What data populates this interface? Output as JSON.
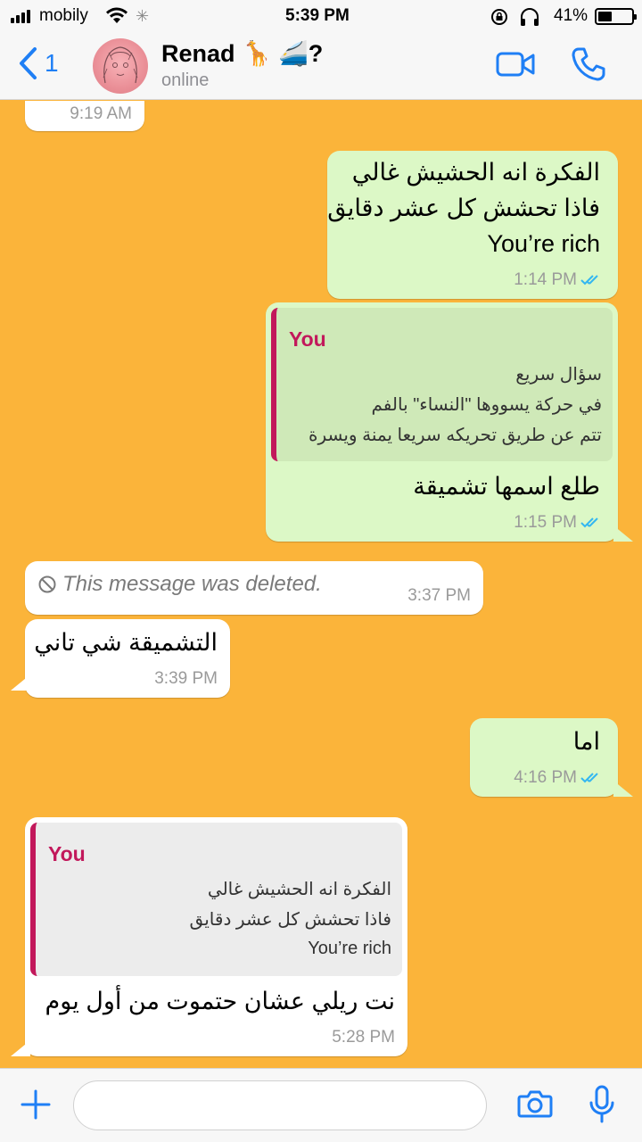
{
  "status_bar": {
    "carrier": "mobily",
    "time": "5:39 PM",
    "battery_percent": "41%",
    "battery_level": 0.41,
    "icons": [
      "signal-icon",
      "wifi-icon",
      "loading-icon",
      "rotation-lock-icon",
      "headphones-icon",
      "battery-icon"
    ]
  },
  "header": {
    "back_count": "1",
    "contact_name": "Renad 🦒 🚄?",
    "contact_status": "online",
    "icons": [
      "back-chevron-icon",
      "avatar",
      "video-call-icon",
      "phone-call-icon"
    ]
  },
  "colors": {
    "chat_background": "#fbb43a",
    "outgoing_bubble": "#dcf8c6",
    "incoming_bubble": "#ffffff",
    "accent_blue": "#1f7ff5",
    "quote_author": "#c2185b",
    "read_ticks": "#34b7f1"
  },
  "messages": [
    {
      "direction": "in",
      "time": "9:19 AM"
    },
    {
      "direction": "out",
      "lines": [
        "الفكرة انه الحشيش غالي",
        "فاذا تحشش كل عشر دقايق",
        "You’re rich"
      ],
      "time": "1:14 PM",
      "status": "read"
    },
    {
      "direction": "out",
      "quote": {
        "author": "You",
        "lines": [
          "سؤال سريع",
          "في حركة يسووها \"النساء\" بالفم",
          "تتم عن طريق تحريكه سريعا يمنة ويسرة"
        ]
      },
      "text": "طلع اسمها تشميقة",
      "time": "1:15 PM",
      "status": "read"
    },
    {
      "direction": "in",
      "deleted_text": "This message was deleted.",
      "time": "3:37 PM"
    },
    {
      "direction": "in",
      "text": "التشميقة شي تاني",
      "time": "3:39 PM"
    },
    {
      "direction": "out",
      "text": "اما",
      "time": "4:16 PM",
      "status": "read"
    },
    {
      "direction": "in",
      "quote": {
        "author": "You",
        "lines": [
          "الفكرة انه الحشيش غالي",
          "فاذا تحشش كل عشر دقايق",
          "You’re rich"
        ]
      },
      "text": "نت ريلي عشان حتموت من أول يوم",
      "time": "5:28 PM"
    }
  ],
  "input_bar": {
    "placeholder": "",
    "icons": [
      "plus-icon",
      "camera-icon",
      "microphone-icon"
    ]
  }
}
